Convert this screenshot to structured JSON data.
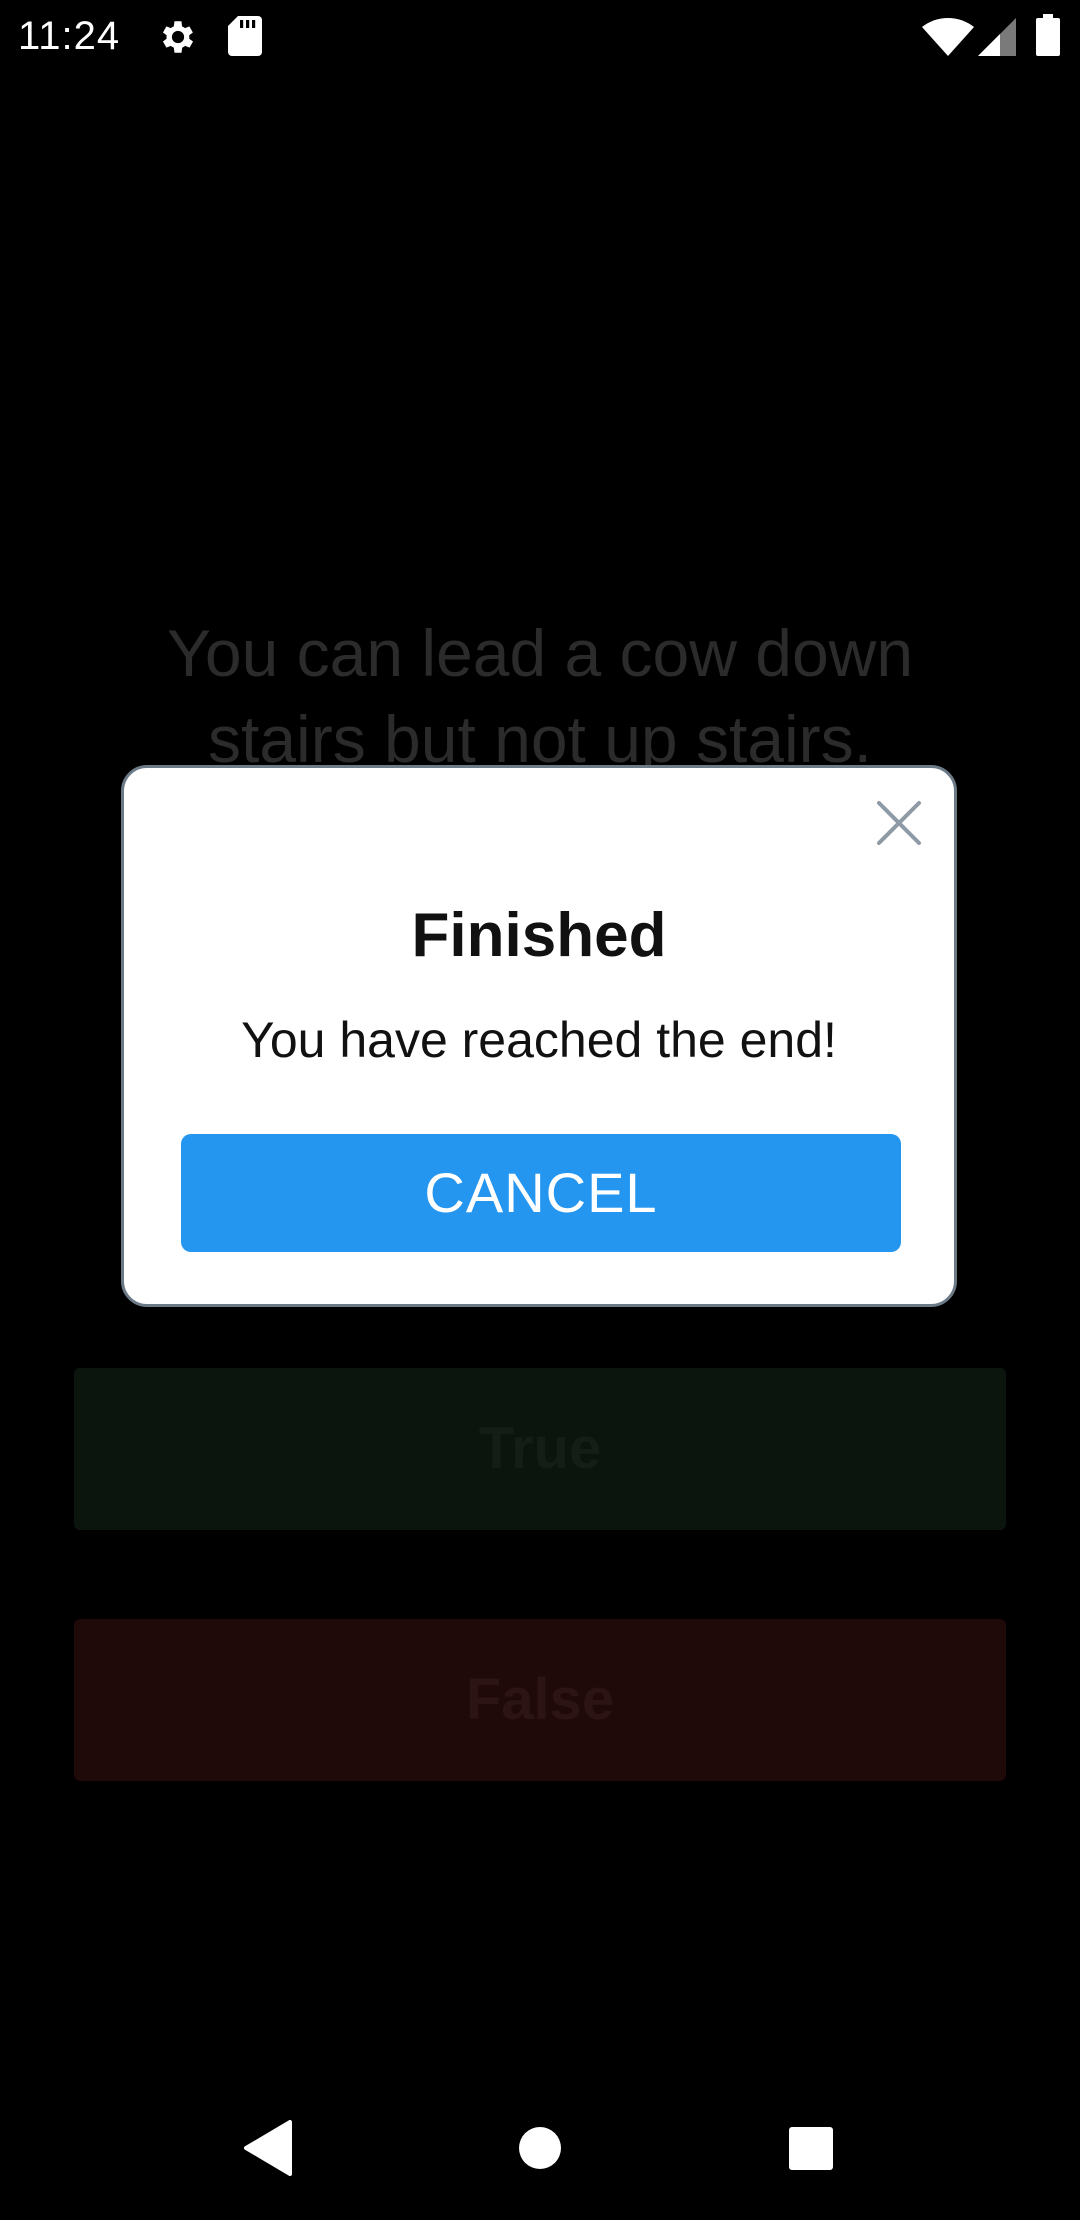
{
  "status_bar": {
    "time": "11:24",
    "icons": [
      "gear-icon",
      "sd-card-icon",
      "wifi-icon",
      "signal-icon",
      "battery-icon"
    ]
  },
  "question": {
    "text": "You can lead a cow down stairs but not up stairs."
  },
  "answers": {
    "true_label": "True",
    "false_label": "False",
    "true_color": "#0b150d",
    "false_color": "#1f0909"
  },
  "dialog": {
    "title": "Finished",
    "message": "You have reached the end!",
    "cancel_label": "CANCEL",
    "close_icon": "close-icon",
    "accent_color": "#2596f0"
  },
  "nav_bar": {
    "icons": [
      "back-icon",
      "home-icon",
      "recents-icon"
    ]
  }
}
